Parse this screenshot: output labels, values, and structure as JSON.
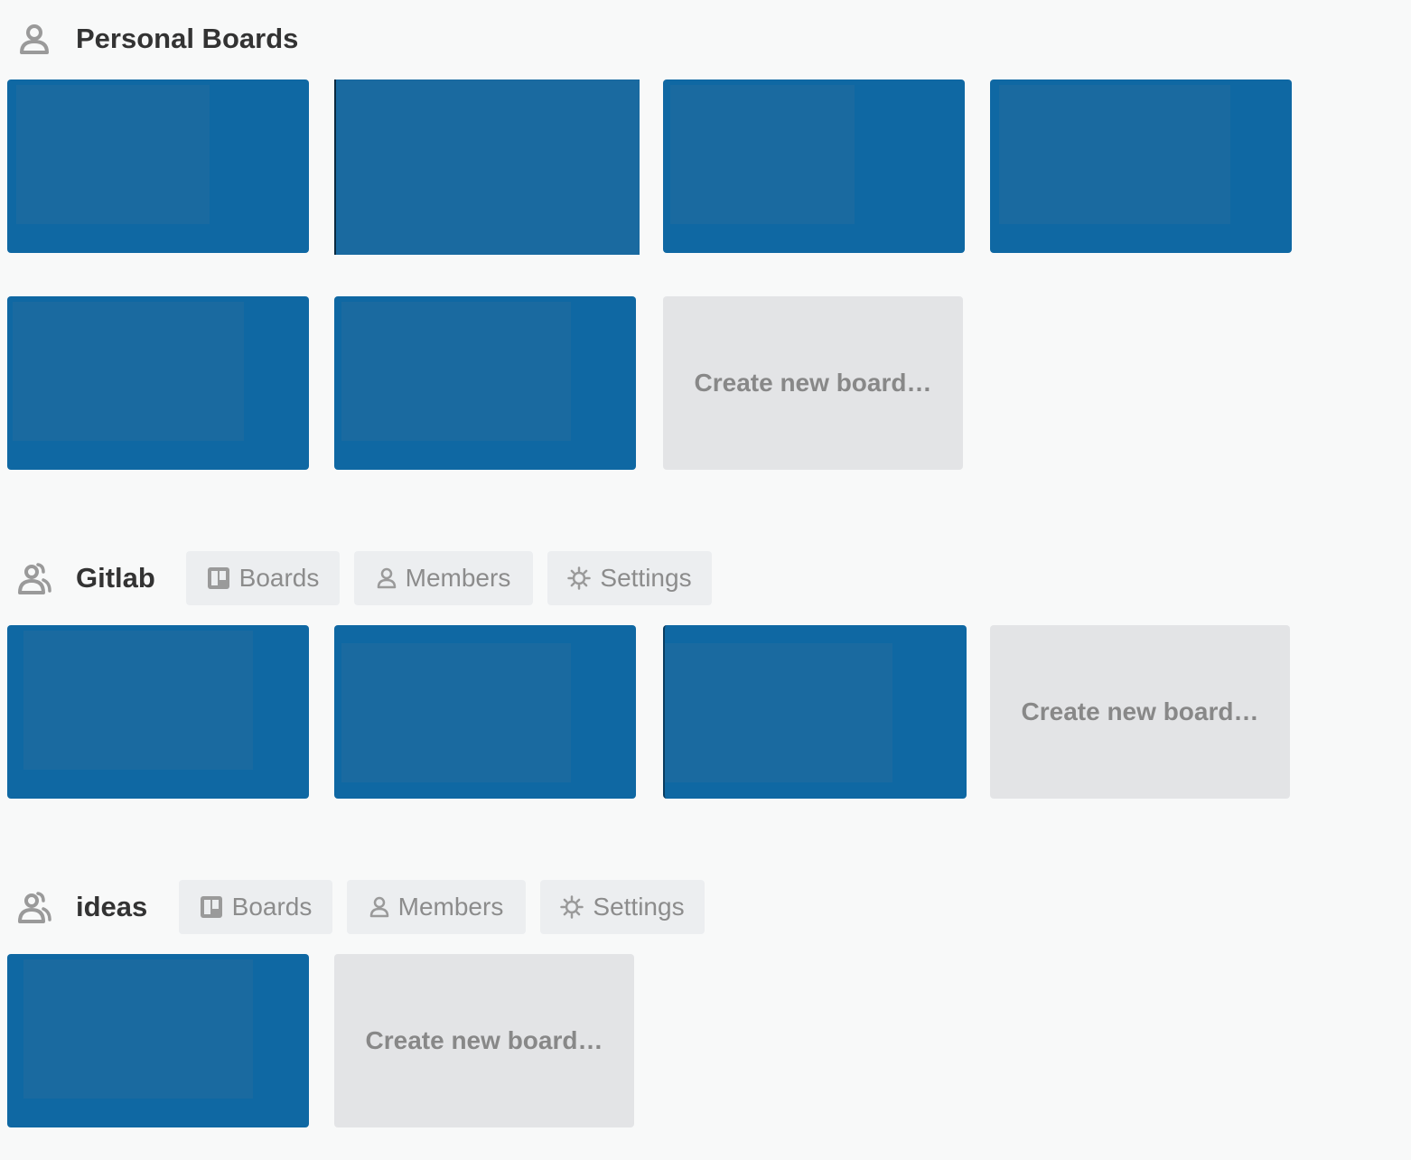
{
  "sections": [
    {
      "title": "Personal Boards",
      "icon": "person-icon",
      "boards_count": 6,
      "create_label": "Create new board…"
    },
    {
      "title": "Gitlab",
      "icon": "team-icon",
      "tabs": [
        {
          "label": "Boards",
          "icon": "board-icon"
        },
        {
          "label": "Members",
          "icon": "person-icon"
        },
        {
          "label": "Settings",
          "icon": "gear-icon"
        }
      ],
      "boards_count": 3,
      "create_label": "Create new board…"
    },
    {
      "title": "ideas",
      "icon": "team-icon",
      "tabs": [
        {
          "label": "Boards",
          "icon": "board-icon"
        },
        {
          "label": "Members",
          "icon": "person-icon"
        },
        {
          "label": "Settings",
          "icon": "gear-icon"
        }
      ],
      "boards_count": 1,
      "create_label": "Create new board…"
    }
  ],
  "colors": {
    "board_tile": "#0f68a3",
    "create_tile": "#e3e4e6",
    "background": "#f8f9f9"
  }
}
